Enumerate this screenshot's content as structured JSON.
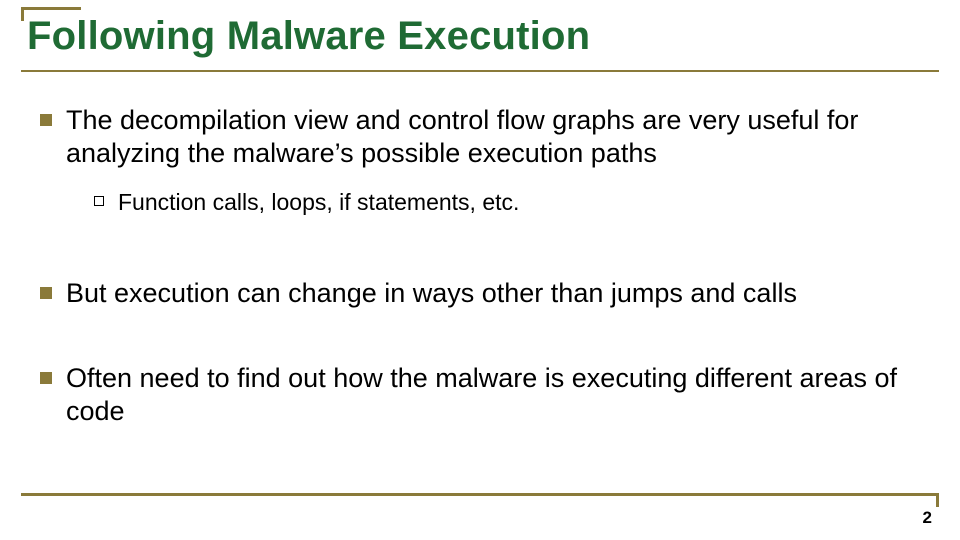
{
  "title": "Following Malware Execution",
  "bullets": [
    {
      "text": "The decompilation view and control flow graphs are very useful for analyzing the malware’s possible execution paths",
      "sub": [
        {
          "text": "Function calls, loops, if statements, etc."
        }
      ]
    },
    {
      "text": "But execution can change in ways other than jumps and calls",
      "sub": []
    },
    {
      "text": "Often need to find out how the malware is executing different areas of code",
      "sub": []
    }
  ],
  "page_number": "2",
  "colors": {
    "title": "#1f6b34",
    "accent": "#8a7a3a"
  }
}
